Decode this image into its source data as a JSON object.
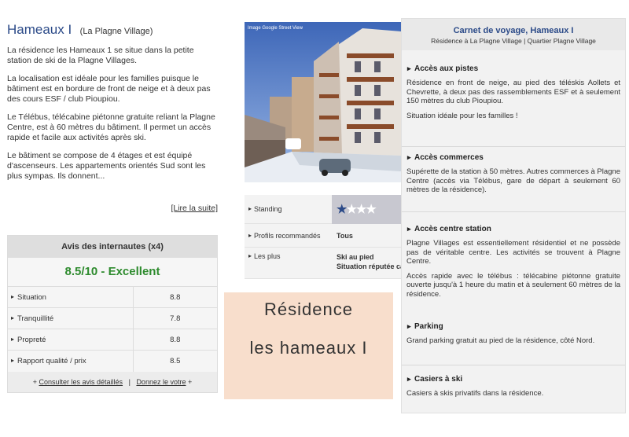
{
  "intro": {
    "title": "Hameaux I",
    "subtitle": "(La Plagne Village)",
    "paragraphs": [
      "La résidence les Hameaux 1 se situe dans la petite station de ski de la Plagne Villages.",
      "La localisation est idéale pour les familles puisque le bâtiment est en bordure de front de neige et à deux pas des cours ESF / club Pioupiou.",
      "Le Télébus, télécabine piétonne gratuite reliant la Plagne Centre, est à 60 mètres du bâtiment. Il permet un accès rapide et facile aux activités après ski.",
      "Le bâtiment se compose de 4 étages et est équipé d'ascenseurs. Les appartements orientés Sud sont les plus sympas. Ils donnent..."
    ],
    "read_more": "[Lire la suite]"
  },
  "reviews": {
    "header": "Avis des internautes (x4)",
    "score": "8.5/10 - Excellent",
    "rows": [
      {
        "label": "Situation",
        "value": "8.8"
      },
      {
        "label": "Tranquillité",
        "value": "7.8"
      },
      {
        "label": "Propreté",
        "value": "8.8"
      },
      {
        "label": "Rapport qualité / prix",
        "value": "8.5"
      }
    ],
    "footer_prefix": "+",
    "footer_link1": "Consulter les avis détaillés",
    "footer_sep": "|",
    "footer_link2": "Donnez le votre",
    "footer_suffix": "+"
  },
  "photo": {
    "caption": "Image Google Street View"
  },
  "info": {
    "standing_label": "Standing",
    "standing_stars": 1,
    "standing_max": 4,
    "profiles_label": "Profils recommandés",
    "profiles_value": "Tous",
    "plus_label": "Les plus",
    "plus_values": [
      "Ski au pied",
      "Situation réputée calme"
    ]
  },
  "card": {
    "line1": "Résidence",
    "line2": "les hameaux I"
  },
  "carnet": {
    "title": "Carnet de voyage, Hameaux I",
    "subtitle": "Résidence à La Plagne Village | Quartier Plagne Village",
    "sections": [
      {
        "title": "Accès aux pistes",
        "paragraphs": [
          "Résidence en front de neige, au pied des téléskis Aollets et Chevrette, à deux pas des rassemblements ESF et à seulement 150 mètres du club Pioupiou.",
          "Situation idéale pour les familles !"
        ]
      },
      {
        "title": "Accès commerces",
        "paragraphs": [
          "Supérette de la station à 50 mètres. Autres commerces à Plagne Centre (accès via Télébus, gare de départ à seulement 60 mètres de la résidence)."
        ]
      },
      {
        "title": "Accès centre station",
        "paragraphs": [
          "Plagne Villages est essentiellement résidentiel et ne possède pas de véritable centre. Les activités se trouvent à Plagne Centre.",
          "Accès rapide avec le télébus : télécabine piétonne gratuite ouverte jusqu'à 1 heure du matin et à seulement 60 mètres de la résidence."
        ]
      },
      {
        "title": "Parking",
        "paragraphs": [
          "Grand parking gratuit au pied de la résidence, côté Nord."
        ]
      },
      {
        "title": "Casiers à ski",
        "paragraphs": [
          "Casiers à skis privatifs dans la résidence."
        ]
      }
    ]
  }
}
